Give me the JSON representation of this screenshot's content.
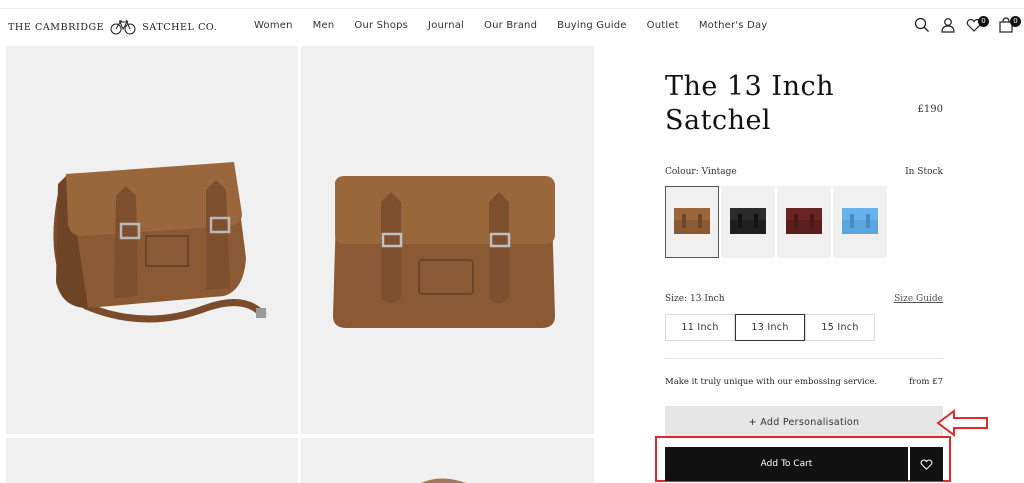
{
  "header": {
    "logo_left": "THE CAMBRIDGE",
    "logo_right": "SATCHEL CO.",
    "nav": [
      "Women",
      "Men",
      "Our Shops",
      "Journal",
      "Our Brand",
      "Buying Guide",
      "Outlet",
      "Mother's Day"
    ],
    "wishlist_count": "0",
    "cart_count": "0"
  },
  "product": {
    "title": "The 13 Inch Satchel",
    "price": "£190",
    "colour_label": "Colour: Vintage",
    "stock": "In Stock",
    "swatches": [
      {
        "name": "Vintage",
        "color": "#8a5a35"
      },
      {
        "name": "Black",
        "color": "#1e1e1e"
      },
      {
        "name": "Oxblood",
        "color": "#5a1e1e"
      },
      {
        "name": "Blue",
        "color": "#5aa6e0"
      }
    ],
    "size_label": "Size: 13 Inch",
    "size_guide": "Size Guide",
    "sizes": [
      "11 Inch",
      "13 Inch",
      "15 Inch"
    ],
    "selected_size": "13 Inch",
    "emboss_text": "Make it truly unique with our embossing service.",
    "emboss_price": "from £7",
    "personalise_label": "+ Add Personalisation",
    "add_to_cart_label": "Add To Cart"
  },
  "colors": {
    "bag_main": "#8b5a34",
    "bag_dark": "#6e4426",
    "highlight": "#e02a2a"
  }
}
